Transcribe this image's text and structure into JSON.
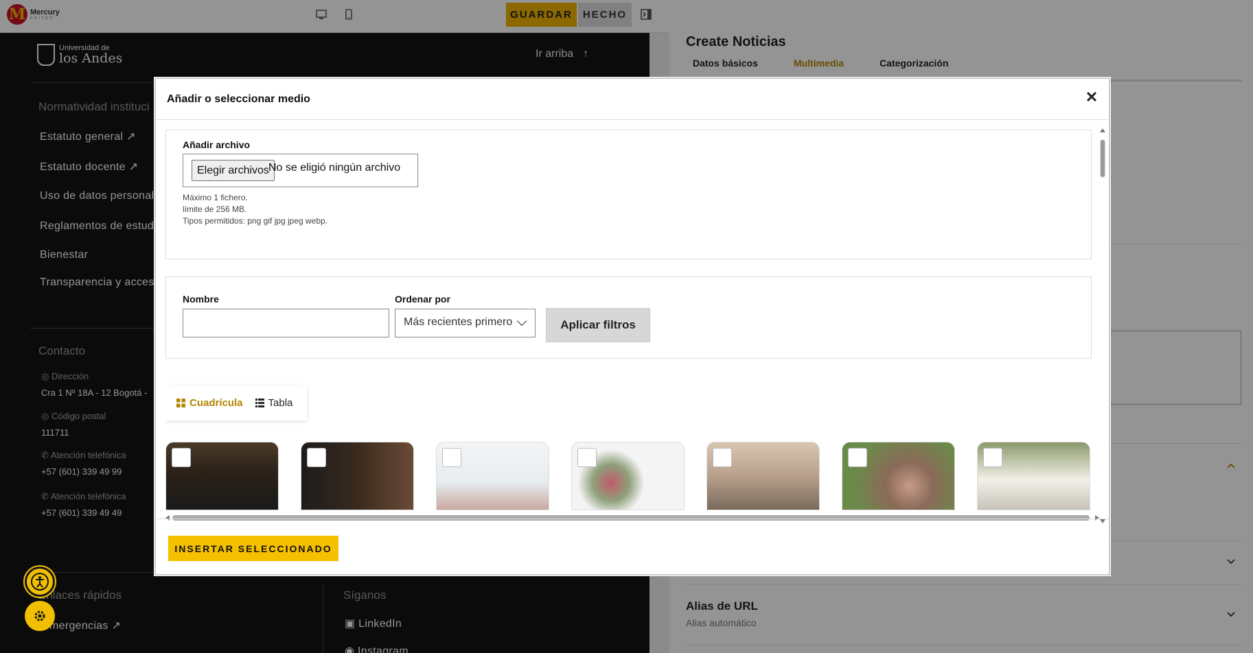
{
  "app": {
    "logo_name": "Mercury",
    "logo_sub": "EDITOR"
  },
  "toolbar": {
    "save_label": "GUARDAR",
    "done_label": "HECHO",
    "icons": [
      "desktop-icon",
      "mobile-icon",
      "sidebar-toggle-icon"
    ]
  },
  "preview": {
    "university_line1": "Universidad de",
    "university_line2": "los Andes",
    "go_top": "Ir arriba",
    "section_normatividad": "Normatividad instituci",
    "links": [
      "Estatuto general",
      "Estatuto docente",
      "Uso de datos personale",
      "Reglamentos de estudi",
      "Bienestar",
      "Transparencia y acceso"
    ],
    "section_contacto": "Contacto",
    "contact": [
      {
        "label": "Dirección",
        "value": "Cra 1 Nº 18A - 12 Bogotá -"
      },
      {
        "label": "Código postal",
        "value": "111711"
      },
      {
        "label": "Atención telefónica",
        "value": "+57 (601) 339 49 99"
      },
      {
        "label": "Atención telefónica",
        "value": "+57 (601) 339 49 49"
      }
    ],
    "section_enlaces": "Enlaces rápidos",
    "enlace_1": "mergencias",
    "section_siganos": "Síganos",
    "social": [
      "LinkedIn",
      "Instagram"
    ]
  },
  "sidebar": {
    "title": "Create Noticias",
    "tabs": [
      {
        "label": "Datos básicos",
        "active": false
      },
      {
        "label": "Multimedia",
        "active": true
      },
      {
        "label": "Categorización",
        "active": false
      }
    ],
    "alias_title": "Alias de URL",
    "alias_sub": "Alias automático"
  },
  "dialog": {
    "title": "Añadir o seleccionar medio",
    "close_label": "✕",
    "upload": {
      "label": "Añadir archivo",
      "button": "Elegir archivos",
      "no_file": "No se eligió ningún archivo",
      "help": [
        "Máximo 1 fichero.",
        "límite de 256 MB.",
        "Tipos permitidos: png gif jpg jpeg webp."
      ]
    },
    "filters": {
      "name_label": "Nombre",
      "name_value": "",
      "sort_label": "Ordenar por",
      "sort_value": "Más recientes primero",
      "apply": "Aplicar filtros"
    },
    "view": {
      "grid": "Cuadrícula",
      "table": "Tabla",
      "active": "grid"
    },
    "media_count_visible": 7,
    "insert": "INSERTAR SELECCIONADO"
  },
  "colors": {
    "accent": "#f0b400",
    "active_tab": "#b38600",
    "dark_bg": "#141414"
  }
}
